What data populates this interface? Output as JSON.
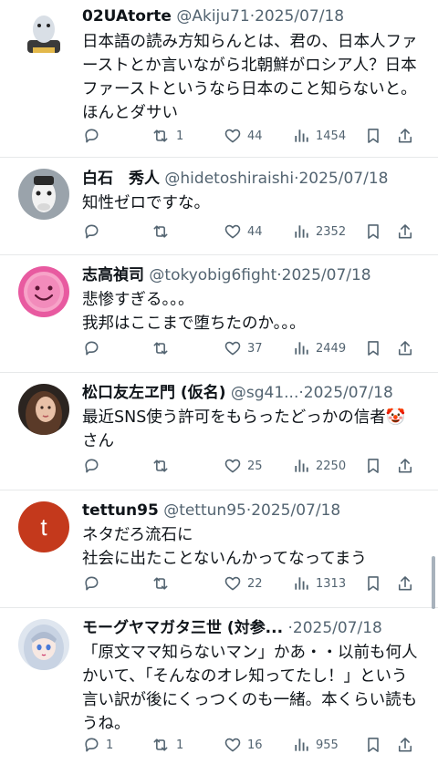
{
  "posts": [
    {
      "name": "02UAtorte",
      "handle": "@Akiju71",
      "dot": "·",
      "date": "2025/07/18",
      "lines": [
        "日本語の読み方知らんとは、君の、日本人ファ",
        "ーストとか言いながら北朝鮮がロシア人？日本",
        "ファーストというなら日本のこと知らないと。",
        "ほんとダサい"
      ],
      "reply_count": "",
      "repost_count": "1",
      "like_count": "44",
      "view_count": "1454",
      "avatar_icon": "person-figure-avatar"
    },
    {
      "name": "白石　秀人",
      "handle": "@hidetoshiraishi",
      "dot": "·",
      "date": "2025/07/18",
      "lines": [
        "知性ゼロですな。"
      ],
      "reply_count": "",
      "repost_count": "",
      "like_count": "44",
      "view_count": "2352",
      "avatar_icon": "horse-avatar"
    },
    {
      "name": "志高禎司",
      "handle": "@tokyobig6fight",
      "dot": "·",
      "date": "2025/07/18",
      "lines": [
        "悲惨すぎる。。。",
        "我邦はここまで堕ちたのか。。。"
      ],
      "reply_count": "",
      "repost_count": "",
      "like_count": "37",
      "view_count": "2449",
      "avatar_icon": "pink-smiley-avatar"
    },
    {
      "name": "松口友左ヱ門 (仮名)",
      "handle": "@sg41...",
      "dot": "·",
      "date": "2025/07/18",
      "lines": [
        "最近SNS使う許可をもらったどっかの信者🤡",
        "さん"
      ],
      "reply_count": "",
      "repost_count": "",
      "like_count": "25",
      "view_count": "2250",
      "avatar_icon": "woman-portrait-avatar"
    },
    {
      "name": "tettun95",
      "handle": "@tettun95",
      "dot": "·",
      "date": "2025/07/18",
      "lines": [
        "ネタだろ流石に",
        "社会に出たことないんかってなってまう"
      ],
      "reply_count": "",
      "repost_count": "",
      "like_count": "22",
      "view_count": "1313",
      "avatar_icon": "letter-t-avatar",
      "avatar_letter": "t"
    },
    {
      "name": "モーグヤマガタ三世 (対参...",
      "handle": "",
      "dot": "·",
      "date": "2025/07/18",
      "lines": [
        "「原文ママ知らないマン」かあ・・以前も何人",
        "かいて、「そんなのオレ知ってたし！」という",
        "言い訳が後にくっつくのも一緒。本くらい読も",
        "うね。"
      ],
      "reply_count": "1",
      "repost_count": "1",
      "like_count": "16",
      "view_count": "955",
      "avatar_icon": "anime-girl-avatar"
    }
  ],
  "colors": {
    "text": "#0f1419",
    "secondary": "#536471",
    "divider": "#e7e9ea",
    "t_avatar": "#c4391c"
  },
  "icons": [
    "reply-icon",
    "repost-icon",
    "like-icon",
    "views-icon",
    "bookmark-icon",
    "share-icon"
  ]
}
